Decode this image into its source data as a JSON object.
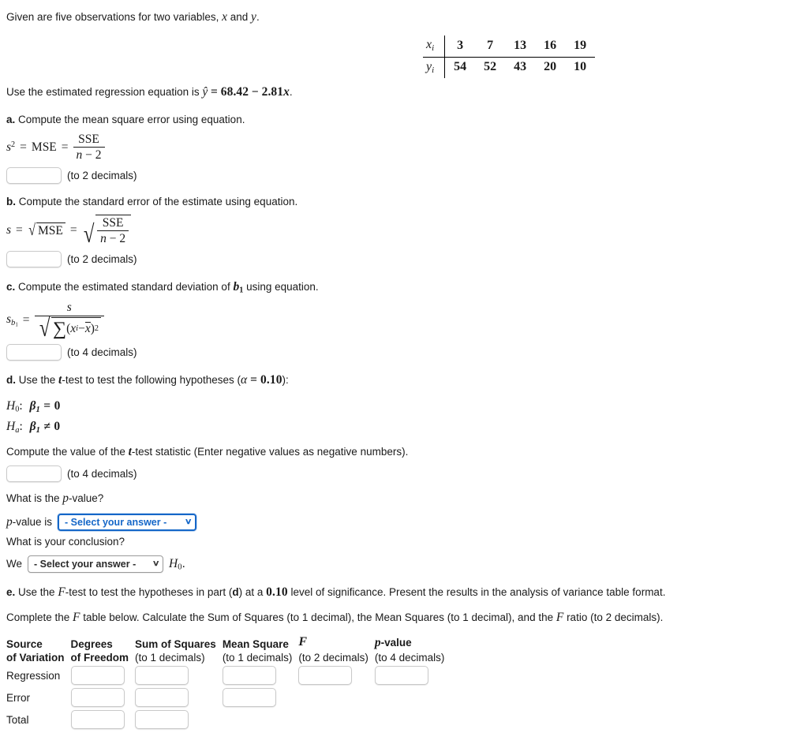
{
  "intro": {
    "text_before": "Given are five observations for two variables, ",
    "var_x": "x",
    "text_mid": " and ",
    "var_y": "y",
    "text_after": "."
  },
  "observations": {
    "x_label": "x",
    "x_sub": "i",
    "y_label": "y",
    "y_sub": "i",
    "x_values": [
      "3",
      "7",
      "13",
      "16",
      "19"
    ],
    "y_values": [
      "54",
      "52",
      "43",
      "20",
      "10"
    ]
  },
  "regression": {
    "text_before": "Use the estimated regression equation is ",
    "equation": "ŷ = 68.42 − 2.81x",
    "y_hat": "ŷ",
    "equals": "=",
    "intercept": "68.42",
    "minus": "−",
    "slope": "2.81",
    "var_x": "x",
    "period": "."
  },
  "part_a": {
    "letter": "a.",
    "prompt": "Compute the mean square error using equation.",
    "formula": {
      "lhs_s": "s",
      "lhs_exp": "2",
      "eq1": "=",
      "mse": "MSE",
      "eq2": "=",
      "numerator": "SSE",
      "den_n": "n",
      "den_minus": "−",
      "den_2": "2"
    },
    "input_value": "",
    "hint": "(to 2 decimals)"
  },
  "part_b": {
    "letter": "b.",
    "prompt": "Compute the standard error of the estimate using equation.",
    "formula": {
      "lhs_s": "s",
      "eq1": "=",
      "radical_mse": "MSE",
      "eq2": "=",
      "numerator": "SSE",
      "den_n": "n",
      "den_minus": "−",
      "den_2": "2"
    },
    "input_value": "",
    "hint": "(to 2 decimals)"
  },
  "part_c": {
    "letter": "c.",
    "prompt_before": "Compute the estimated standard deviation of ",
    "prompt_var": "b",
    "prompt_var_sub": "1",
    "prompt_after": " using equation.",
    "formula": {
      "lhs_s": "s",
      "lhs_sub_b": "b",
      "lhs_sub_1": "1",
      "eq": "=",
      "numerator": "s",
      "sum_symbol": "∑",
      "open_paren": "(",
      "x_i": "x",
      "x_i_sub": "i",
      "minus": "−",
      "x_bar": "x",
      "close_paren": ")",
      "exponent": "2"
    },
    "input_value": "",
    "hint": "(to 4 decimals)"
  },
  "part_d": {
    "letter": "d.",
    "prompt_before": "Use the ",
    "t_symbol": "t",
    "prompt_mid": "-test to test the following hypotheses (",
    "alpha": "α",
    "alpha_eq": " = ",
    "alpha_value": "0.10",
    "prompt_after": "):",
    "h0": {
      "name": "H",
      "sub": "0",
      "colon": ":",
      "beta": "β",
      "beta_sub": "1",
      "op": "=",
      "value": "0"
    },
    "ha": {
      "name": "H",
      "sub": "a",
      "colon": ":",
      "beta": "β",
      "beta_sub": "1",
      "op": "≠",
      "value": "0"
    },
    "statistic_prompt_before": "Compute the value of the ",
    "statistic_t": "t",
    "statistic_prompt_after": "-test statistic (Enter negative values as negative numbers).",
    "statistic_input_value": "",
    "statistic_hint": "(to 4 decimals)",
    "pvalue_question": "What is the ",
    "pvalue_p": "p",
    "pvalue_question_after": "-value?",
    "pvalue_label_p": "p",
    "pvalue_label_after": "-value is",
    "pvalue_select": {
      "selected": "- Select your answer -",
      "chevron": "∨",
      "focused": true
    },
    "conclusion_question": "What is your conclusion?",
    "conclusion_we": "We",
    "conclusion_select": {
      "selected": "- Select your answer -",
      "chevron": "∨",
      "focused": false
    },
    "conclusion_h": "H",
    "conclusion_h_sub": "0",
    "conclusion_period": "."
  },
  "part_e": {
    "letter": "e.",
    "prompt_before": "Use the ",
    "f_symbol": "F",
    "prompt_mid": "-test to test the hypotheses in part (",
    "part_ref": "d",
    "prompt_mid2": ") at a ",
    "alpha_value": "0.10",
    "prompt_after": " level of significance. Present the results in the analysis of variance table format.",
    "instruction_before": "Complete the ",
    "instruction_f": "F",
    "instruction_mid": " table below. Calculate the Sum of Squares (to 1 decimal), the Mean Squares (to 1 decimal), and the ",
    "instruction_f2": "F",
    "instruction_after": " ratio (to 2 decimals)."
  },
  "anova_table": {
    "headers": [
      {
        "line1": "Source",
        "line2": "of Variation",
        "line2_bold": true
      },
      {
        "line1": "Degrees",
        "line2": "of Freedom",
        "line2_bold": true
      },
      {
        "line1": "Sum of Squares",
        "line2": "(to 1 decimals)",
        "line2_bold": false
      },
      {
        "line1": "Mean Square",
        "line2": "(to 1 decimals)",
        "line2_bold": false
      },
      {
        "line1": "F",
        "line2": "(to 2 decimals)",
        "line2_bold": false,
        "italic_math": true
      },
      {
        "line1": "p-value",
        "line2": "(to 4 decimals)",
        "line2_bold": false,
        "p_math": true
      }
    ],
    "rows": [
      {
        "source": "Regression",
        "cells": [
          "",
          "",
          "",
          "",
          ""
        ],
        "cell_count": 5
      },
      {
        "source": "Error",
        "cells": [
          "",
          "",
          ""
        ],
        "cell_count": 3
      },
      {
        "source": "Total",
        "cells": [
          "",
          ""
        ],
        "cell_count": 2
      }
    ]
  },
  "colors": {
    "focus_blue": "#1567c8",
    "text": "#1a1a1a",
    "input_border": "#c9c9c9",
    "select_border": "#9a9a9a"
  }
}
